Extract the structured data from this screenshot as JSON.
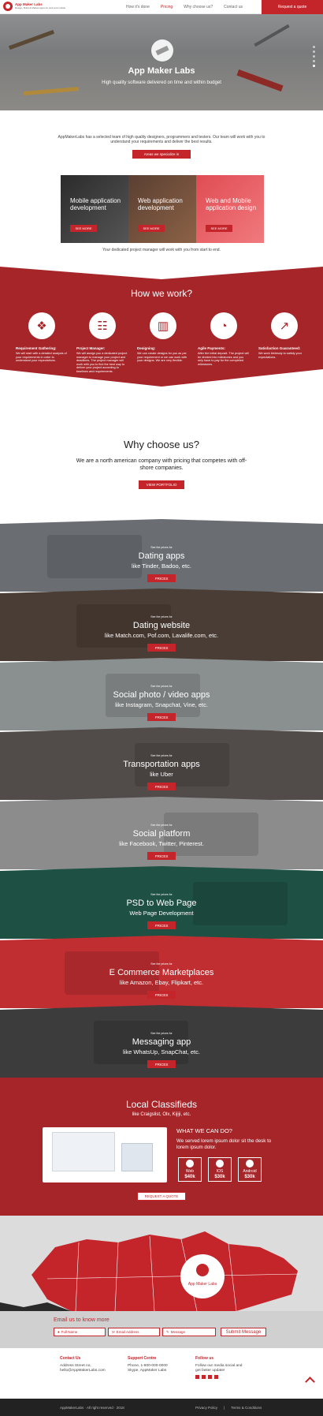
{
  "nav": {
    "brand": "App Maker Labs",
    "tagline": "Design, Build & Market apps for web and mobile",
    "links": [
      "How it's done",
      "Pricing",
      "Why choose us?",
      "Contact us"
    ],
    "active_link": "Pricing",
    "cta": "Request a quote"
  },
  "hero": {
    "title": "App Maker Labs",
    "subtitle": "High quality software delivered on time and within budget"
  },
  "intro": {
    "text": "AppMakerLabs has a selected team of high quality designers, programmers and testers. Our team will work with you to understand your requirements and deliver the best results.",
    "button": "Areas we specialize in"
  },
  "services": [
    {
      "title": "Mobile application development",
      "button": "SEE MORE",
      "color": "#3a3a3a"
    },
    {
      "title": "Web application development",
      "button": "SEE MORE",
      "color": "#6b4b3a"
    },
    {
      "title": "Web and Mobile application design",
      "button": "SEE MORE",
      "color": "#e0484f"
    }
  ],
  "dedicated": "Your dedicated project manager will work with you from start to end.",
  "how": {
    "title": "How we work?",
    "steps": [
      {
        "icon": "team-icon",
        "glyph": "❖",
        "title": "Requirement Gathering:",
        "text": "We will start with a detailed analysis of your requirements in order to understand your expectations."
      },
      {
        "icon": "manager-icon",
        "glyph": "☷",
        "title": "Project Manager:",
        "text": "We will assign you a dedicated project manager to manage your project and deadlines. The project manager will work with you to find the best way to deliver your project according to timelines and requirements."
      },
      {
        "icon": "chart-icon",
        "glyph": "▥",
        "title": "Designing:",
        "text": "We can create designs for you as per your requirement or we can work with your designs. We are very flexible."
      },
      {
        "icon": "pie-chart-icon",
        "glyph": "◔",
        "title": "Agile Payments:",
        "text": "After the initial deposit. The project will be divided into milestones and you only have to pay for the completed milestones."
      },
      {
        "icon": "growth-chart-icon",
        "glyph": "↗",
        "title": "Satisfaction Guaranteed:",
        "text": "We work tirelessly to satisfy your expectations."
      }
    ]
  },
  "why": {
    "title": "Why choose us?",
    "subtitle": "We are a north american company with pricing that competes with off-shore companies.",
    "button": "VIEW PORTFOLIO"
  },
  "apps": [
    {
      "pre": "See the prices for",
      "title": "Dating apps",
      "sub": "like Tinder, Badoo, etc.",
      "button": "PRICES",
      "color": "#6a6e72"
    },
    {
      "pre": "See the prices for",
      "title": "Dating website",
      "sub": "like Match.com, Pof.com, Lavalife.com, etc.",
      "button": "PRICES",
      "color": "#4a3d35"
    },
    {
      "pre": "See the prices for",
      "title": "Social photo / video apps",
      "sub": "like Instagram, Snapchat, Vine, etc.",
      "button": "PRICES",
      "color": "#8a8f90"
    },
    {
      "pre": "See the prices for",
      "title": "Transportation apps",
      "sub": "like Uber",
      "button": "PRICES",
      "color": "#514c49"
    },
    {
      "pre": "See the prices for",
      "title": "Social platform",
      "sub": "like Facebook, Twitter, Pinterest.",
      "button": "PRICES",
      "color": "#8c8c8c"
    },
    {
      "pre": "See the prices for",
      "title": "PSD to Web Page",
      "sub": "Web Page Development",
      "button": "PRICES",
      "color": "#1f5044"
    },
    {
      "pre": "See the prices for",
      "title": "E Commerce Marketplaces",
      "sub": "like Amazon, Ebay, Flipkart, etc.",
      "button": "PRICES",
      "color": "#c02e32"
    },
    {
      "pre": "See the prices for",
      "title": "Messaging app",
      "sub": "like WhatsUp, SnapChat, etc.",
      "button": "PRICES",
      "color": "#3c3c3c"
    }
  ],
  "local": {
    "title": "Local Classifieds",
    "subtitle": "like Craigslist, Olx, Kijiji, etc.",
    "can_title": "WHAT WE CAN DO?",
    "can_text": "We served lorem ipsum dolor sit the desk to lorem ipsum dolor.",
    "prices": [
      {
        "name": "Web",
        "value": "$40k"
      },
      {
        "name": "IOS",
        "value": "$30k"
      },
      {
        "name": "Android",
        "value": "$30k"
      }
    ],
    "button": "REQUEST A QUOTE"
  },
  "map": {
    "label": "App Maker Labs"
  },
  "email": {
    "title": "Email us to know more",
    "name_placeholder": "Full Name",
    "email_placeholder": "Email Address",
    "message_placeholder": "Message",
    "submit": "Submit Message"
  },
  "footer": {
    "contact_title": "Contact Us",
    "contact_lines": [
      "Address Street no,",
      "hello@AppMakerLabs.com"
    ],
    "support_title": "Support Centre",
    "support_lines": [
      "Phone, 1-800-000-0000",
      "Skype, AppMaker Labs"
    ],
    "follow_title": "Follow us",
    "follow_lines": [
      "Follow our media social and",
      "get faster update!"
    ],
    "copyright": "AppMakerLabs · All right reserved · 2018",
    "privacy": "Privacy Policy",
    "terms": "Terms & Conditions"
  }
}
